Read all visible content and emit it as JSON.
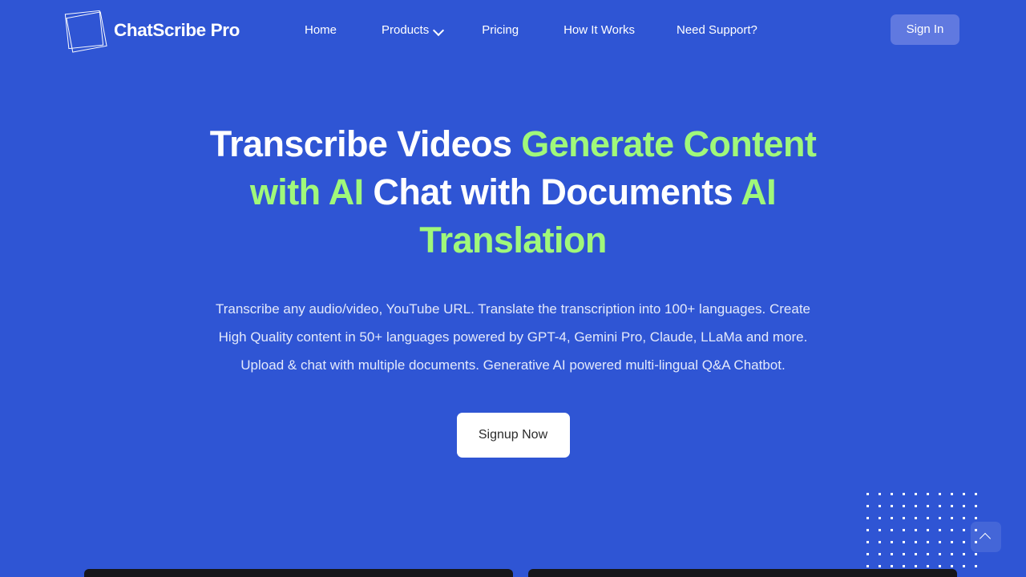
{
  "theme": {
    "background": "#2f55d4",
    "accent_green": "#a0f87a",
    "text_white": "#ffffff",
    "signin_bg": "#6079e0",
    "cta_bg": "#ffffff",
    "card_edge": "#16161a"
  },
  "header": {
    "brand_name": "ChatScribe Pro",
    "logo_icon": "rotated-square-logo-icon",
    "nav": [
      {
        "label": "Home",
        "has_dropdown": false
      },
      {
        "label": "Products",
        "has_dropdown": true,
        "dropdown_icon": "chevron-down-icon"
      },
      {
        "label": "Pricing",
        "has_dropdown": false
      },
      {
        "label": "How It Works",
        "has_dropdown": false
      },
      {
        "label": "Need Support?",
        "has_dropdown": false
      }
    ],
    "signin_label": "Sign In"
  },
  "hero": {
    "headline_parts": [
      {
        "text": "Transcribe Videos ",
        "accent": false
      },
      {
        "text": "Generate Content with AI",
        "accent": true
      },
      {
        "text": " Chat with Documents ",
        "accent": false
      },
      {
        "text": "AI Translation",
        "accent": true
      }
    ],
    "subtitle": "Transcribe any audio/video, YouTube URL. Translate the transcription into 100+ languages. Create High Quality content in 50+ languages powered by GPT-4, Gemini Pro, Claude, LLaMa and more. Upload & chat with multiple documents. Generative AI powered multi-lingual Q&A Chatbot.",
    "cta_label": "Signup Now"
  },
  "decoration": {
    "dot_grid_columns": 10,
    "dot_grid_rows": 7
  },
  "scroll_top": {
    "icon": "chevron-up-icon",
    "label": "Scroll to top"
  }
}
